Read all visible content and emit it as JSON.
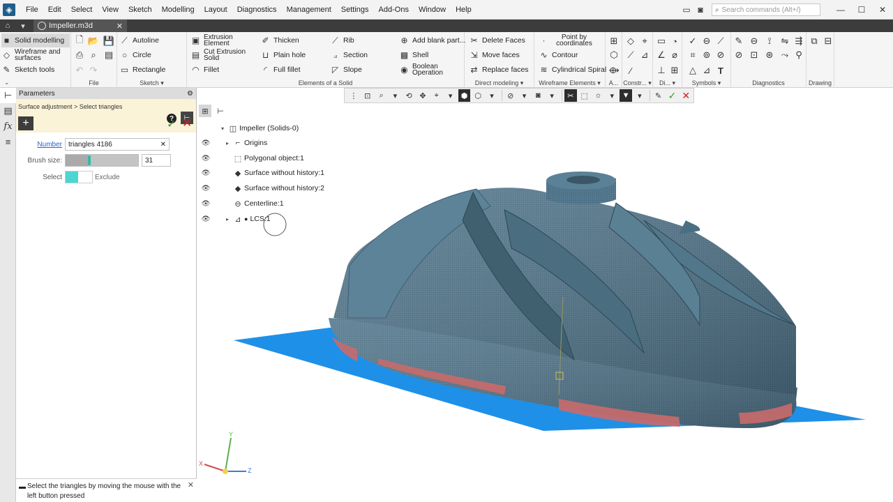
{
  "menu": {
    "items": [
      "File",
      "Edit",
      "Select",
      "View",
      "Sketch",
      "Modelling",
      "Layout",
      "Diagnostics",
      "Management",
      "Settings",
      "Add-Ons",
      "Window",
      "Help"
    ],
    "search_placeholder": "Search commands (Alt+/)"
  },
  "tabbar": {
    "doc_tab": "Impeller.m3d"
  },
  "ribbon": {
    "modes": {
      "solid": "Solid modelling",
      "wireframe": "Wireframe and surfaces",
      "sketch_tools": "Sketch tools"
    },
    "sketch": {
      "autoline": "Autoline",
      "circle": "Circle",
      "rectangle": "Rectangle"
    },
    "solid": {
      "extrusion": "Extrusion Element",
      "cut_extrusion": "Cut Extrusion Solid",
      "fillet": "Fillet",
      "thicken": "Thicken",
      "plain_hole": "Plain hole",
      "full_fillet": "Full fillet",
      "rib": "Rib",
      "section": "Section",
      "slope": "Slope",
      "add_blank": "Add blank part...",
      "shell": "Shell",
      "boolean": "Boolean Operation"
    },
    "direct": {
      "delete_faces": "Delete Faces",
      "move_faces": "Move faces",
      "replace_faces": "Replace faces"
    },
    "wireframe": {
      "point_coords": "Point by coordinates",
      "contour": "Contour",
      "cyl_spiral": "Cylindrical Spiral"
    },
    "group_labels": {
      "file": "File",
      "sketch": "Sketch",
      "elements": "Elements of a Solid",
      "direct": "Direct modeling",
      "wireframe": "Wireframe Elements",
      "a": "A...",
      "constr": "Constr...",
      "di": "Di...",
      "symbols": "Symbols",
      "diagnostics": "Diagnostics",
      "drawing": "Drawing"
    }
  },
  "params": {
    "title": "Parameters",
    "breadcrumb": "Surface adjustment > Select triangles",
    "number_label": "Number",
    "number_value": "triangles 4186",
    "brush_label": "Brush size:",
    "brush_value": "31",
    "brush_level": 0.31,
    "select_label": "Select",
    "exclude_label": "Exclude",
    "hint": "Select the triangles by moving the mouse with the left button pressed"
  },
  "tree": {
    "root": "Impeller (Solids-0)",
    "items": [
      "Origins",
      "Polygonal object:1",
      "Surface without history:1",
      "Surface without history:2",
      "Centerline:1",
      "LCS:1"
    ]
  },
  "triad": {
    "x": "X",
    "y": "Y",
    "z": "Z"
  },
  "colors": {
    "accent": "#2864c8",
    "ok": "#2e9e2e",
    "cancel": "#d42020",
    "brush": "#3cb7a8",
    "plane": "#1e90e8",
    "mesh": "#4a6f85",
    "selected": "#c96a6a"
  }
}
